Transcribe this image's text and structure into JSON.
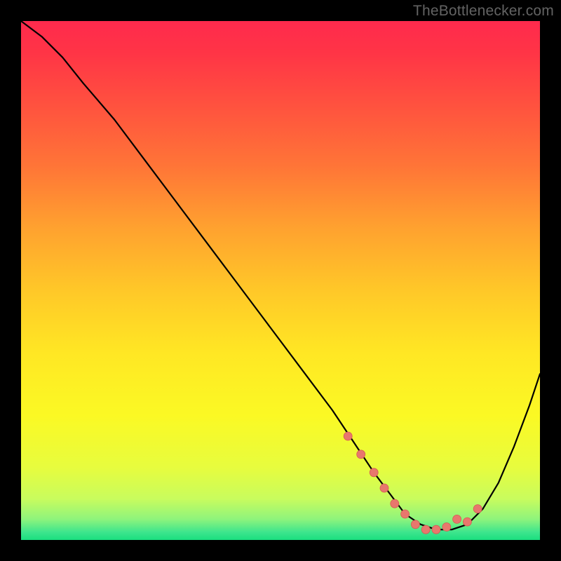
{
  "watermark": "TheBottlenecker.com",
  "colors": {
    "frame": "#000000",
    "curve": "#000000",
    "marker_fill": "#e8776d",
    "marker_stroke": "#d45b52",
    "gradient_stops": [
      {
        "offset": 0.0,
        "color": "#ff2a4d"
      },
      {
        "offset": 0.06,
        "color": "#ff3446"
      },
      {
        "offset": 0.16,
        "color": "#ff513f"
      },
      {
        "offset": 0.28,
        "color": "#ff7537"
      },
      {
        "offset": 0.4,
        "color": "#ffa22f"
      },
      {
        "offset": 0.52,
        "color": "#ffc828"
      },
      {
        "offset": 0.64,
        "color": "#ffe724"
      },
      {
        "offset": 0.76,
        "color": "#fbf924"
      },
      {
        "offset": 0.86,
        "color": "#e7fc3e"
      },
      {
        "offset": 0.92,
        "color": "#c9fc5d"
      },
      {
        "offset": 0.96,
        "color": "#8ef47c"
      },
      {
        "offset": 0.985,
        "color": "#3de58d"
      },
      {
        "offset": 1.0,
        "color": "#1adf7f"
      }
    ]
  },
  "chart_data": {
    "type": "line",
    "title": "",
    "xlabel": "",
    "ylabel": "",
    "x_range": [
      0,
      100
    ],
    "y_range": [
      0,
      100
    ],
    "series": [
      {
        "name": "bottleneck-curve",
        "x": [
          0,
          4,
          8,
          12,
          18,
          24,
          30,
          36,
          42,
          48,
          54,
          60,
          64,
          68,
          71,
          74,
          77,
          80,
          83,
          86,
          89,
          92,
          95,
          98,
          100
        ],
        "y": [
          100,
          97,
          93,
          88,
          81,
          73,
          65,
          57,
          49,
          41,
          33,
          25,
          19,
          13,
          9,
          5,
          3,
          2,
          2,
          3,
          6,
          11,
          18,
          26,
          32
        ]
      }
    ],
    "markers": {
      "name": "highlighted-range",
      "x": [
        63,
        65.5,
        68,
        70,
        72,
        74,
        76,
        78,
        80,
        82,
        84,
        86,
        88
      ],
      "y": [
        20,
        16.5,
        13,
        10,
        7,
        5,
        3,
        2,
        2,
        2.5,
        4,
        3.5,
        6
      ]
    }
  }
}
